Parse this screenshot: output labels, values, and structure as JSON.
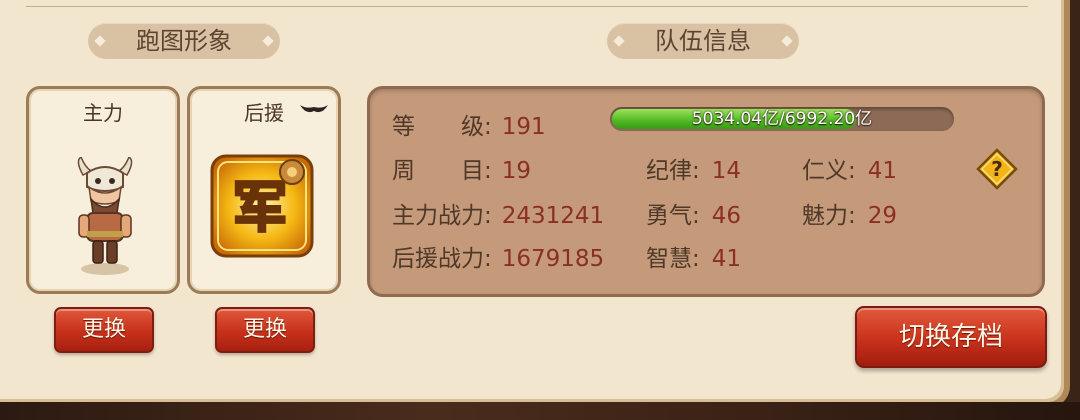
{
  "sections": {
    "left_title": "跑图形象",
    "right_title": "队伍信息"
  },
  "cards": {
    "main_label": "主力",
    "support_label": "后援",
    "support_emblem_char": "军"
  },
  "buttons": {
    "change_main": "更换",
    "change_support": "更换",
    "switch_save": "切换存档"
  },
  "stats": {
    "level_label": "等　　级:",
    "level_value": "191",
    "xp_text": "5034.04亿/6992.20亿",
    "xp_fraction": 0.72,
    "round_label": "周　　目:",
    "round_value": "19",
    "main_power_label": "主力战力:",
    "main_power_value": "2431241",
    "support_power_label": "后援战力:",
    "support_power_value": "1679185",
    "discipline_label": "纪律:",
    "discipline_value": "14",
    "courage_label": "勇气:",
    "courage_value": "46",
    "wisdom_label": "智慧:",
    "wisdom_value": "41",
    "benevolence_label": "仁义:",
    "benevolence_value": "41",
    "charm_label": "魅力:",
    "charm_value": "29"
  },
  "icons": {
    "help": "question-mark-diamond-icon",
    "support_badge": "wing-icon",
    "avatar": "horned-warrior-avatar"
  },
  "colors": {
    "panel_bg": "#f3e6cf",
    "info_bg": "#c49a7a",
    "value_text": "#8a2f22",
    "button_red": "#c6301b",
    "xp_green": "#4fb823"
  }
}
